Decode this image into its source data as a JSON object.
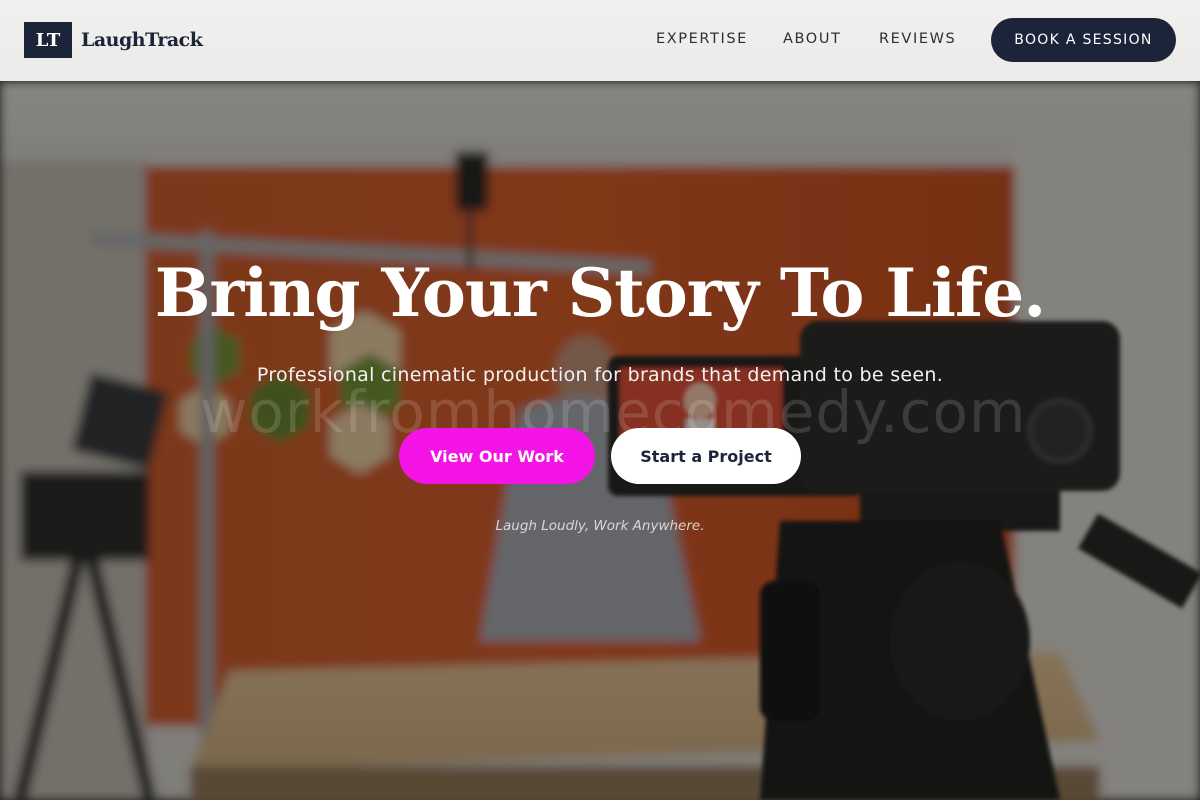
{
  "brand": {
    "mark": "LT",
    "name": "LaughTrack"
  },
  "nav": {
    "links": [
      "EXPERTISE",
      "ABOUT",
      "REVIEWS"
    ],
    "cta": "BOOK A SESSION"
  },
  "hero": {
    "title": "Bring Your Story To Life.",
    "subtitle": "Professional cinematic production for brands that demand to be seen.",
    "watermark": "workfromhomecomedy.com",
    "primary_button": "View Our Work",
    "secondary_button": "Start a Project",
    "tagline": "Laugh Loudly, Work Anywhere."
  },
  "colors": {
    "brand_navy": "#1b2438",
    "accent_magenta": "#f414e6",
    "wall_orange": "#c4471d"
  },
  "icons": {
    "logo": "lt-logo-mark"
  }
}
